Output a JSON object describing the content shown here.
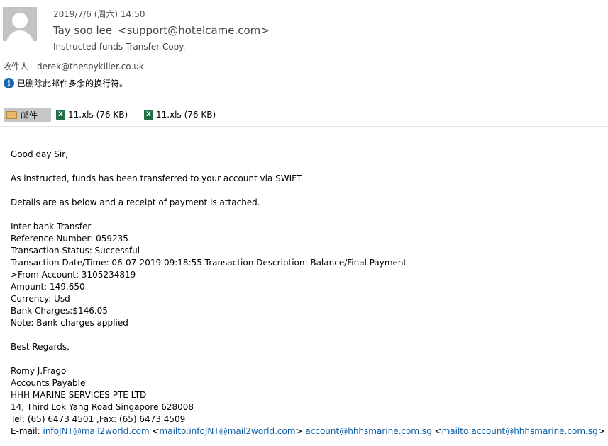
{
  "header": {
    "date": "2019/7/6 (周六) 14:50",
    "sender_name": "Tay soo lee",
    "sender_email": "<support@hotelcame.com>",
    "subject": "Instructed funds Transfer Copy.",
    "recipient_label": "收件人",
    "recipient": "derek@thespykiller.co.uk",
    "notice": "已删除此邮件多余的换行符。"
  },
  "attachments": [
    {
      "label": "邮件",
      "icon": "mail-icon",
      "selected": true
    },
    {
      "label": "11.xls (76 KB)",
      "icon": "excel-icon"
    },
    {
      "label": "11.xls (76 KB)",
      "icon": "excel-icon"
    }
  ],
  "body": {
    "greeting": "Good day Sir,",
    "para1": "As instructed, funds has been transferred to your account via SWIFT.",
    "para2": "Details are as below and a receipt of payment is attached.",
    "details": [
      "Inter-bank Transfer",
      "Reference Number: 059235",
      "Transaction Status: Successful",
      "Transaction Date/Time: 06-07-2019 09:18:55 Transaction Description: Balance/Final Payment",
      ">From Account: 3105234819",
      "Amount: 149,650",
      "Currency: Usd",
      "Bank Charges:$146.05",
      "Note: Bank charges applied"
    ],
    "closing": "Best Regards,",
    "signature": [
      "Romy J.Frago",
      "Accounts Payable",
      "HHH MARINE SERVICES PTE LTD",
      "14, Third Lok Yang Road Singapore 628008",
      "Tel: (65) 6473 4501 ,Fax: (65) 6473 4509"
    ],
    "email_label": "E-mail: ",
    "link1": "infoJNT@mail2world.com",
    "link2": "mailto:infoJNT@mail2world.com",
    "link3": "account@hhhsmarine.com.sg",
    "link4": "mailto:account@hhhsmarine.com.sg"
  },
  "colors": {
    "link": "#0a5aa4",
    "info": "#1a64b4",
    "excel": "#1e7145"
  }
}
